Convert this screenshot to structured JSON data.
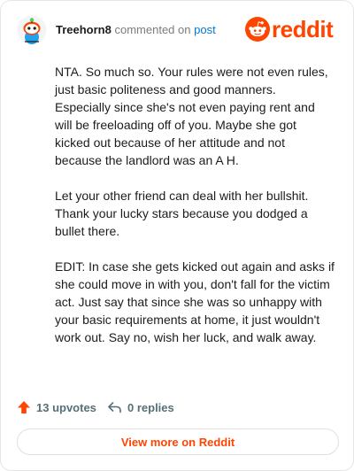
{
  "header": {
    "username": "Treehorn8",
    "action_text": "commented on",
    "post_link": "post",
    "logo_text": "reddit"
  },
  "comment": {
    "paragraphs": [
      "NTA. So much so. Your rules were not even rules, just basic politeness and good manners. Especially since she's not even paying rent and will be freeloading off of you. Maybe she got kicked out because of her attitude and not because the landlord was an A H.",
      "Let your other friend can deal with her bullshit. Thank your lucky stars because you dodged a bullet there.",
      "EDIT: In case she gets kicked out again and asks if she could move in with you, don't fall for the victim act. Just say that since she was so unhappy with your basic requirements at home, it just wouldn't work out. Say no, wish her luck, and walk away."
    ]
  },
  "stats": {
    "upvotes": "13 upvotes",
    "replies": "0 replies"
  },
  "cta": {
    "label": "View more on Reddit"
  },
  "colors": {
    "brand": "#ff4500",
    "link": "#0079d3",
    "upvote_icon": "#ff4500",
    "meta_text": "#576f76"
  },
  "icons": {
    "avatar": "snoo-avatar-icon",
    "logo": "reddit-logo-icon",
    "upvote": "upvote-arrow-icon",
    "reply": "reply-arrow-icon"
  }
}
